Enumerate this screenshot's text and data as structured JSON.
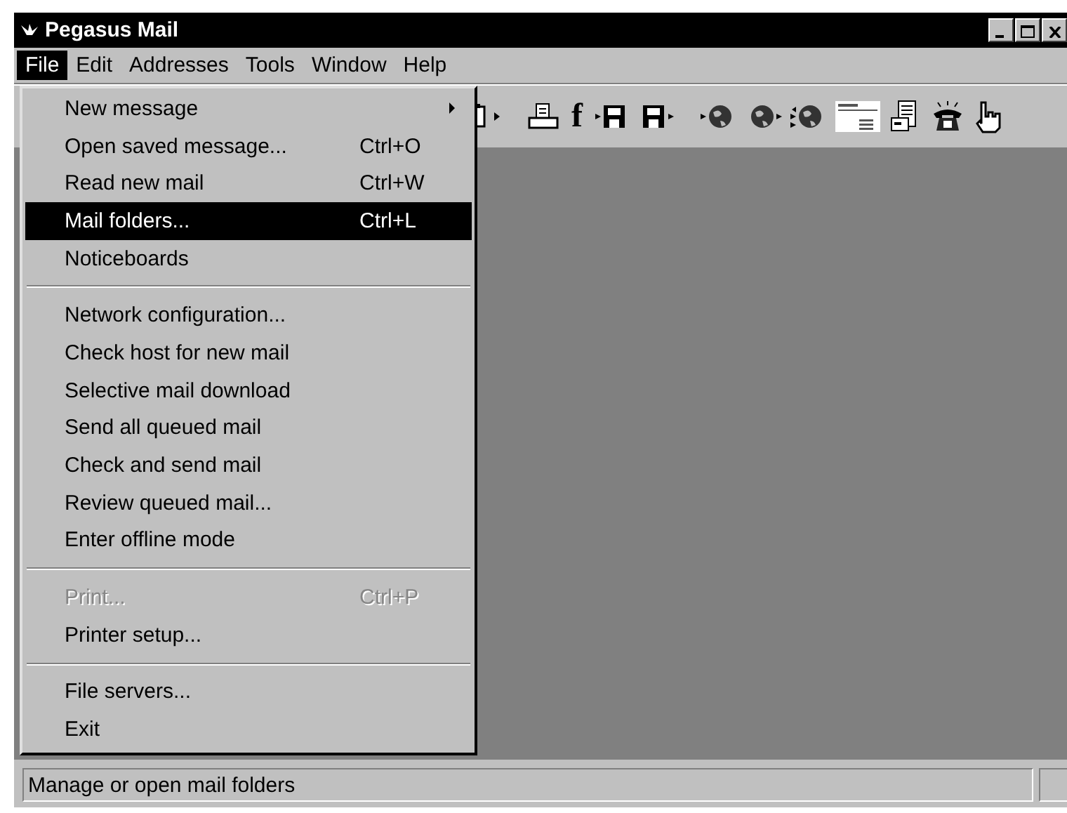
{
  "window": {
    "title": "Pegasus Mail"
  },
  "menu_bar": [
    {
      "label": "File",
      "selected": true
    },
    {
      "label": "Edit",
      "selected": false
    },
    {
      "label": "Addresses",
      "selected": false
    },
    {
      "label": "Tools",
      "selected": false
    },
    {
      "label": "Window",
      "selected": false
    },
    {
      "label": "Help",
      "selected": false
    }
  ],
  "toolbar": [
    {
      "kind": "clipboard-out"
    },
    {
      "kind": "gap"
    },
    {
      "kind": "printer"
    },
    {
      "kind": "letter",
      "label": "f"
    },
    {
      "kind": "disk-in"
    },
    {
      "kind": "disk-out"
    },
    {
      "kind": "gap"
    },
    {
      "kind": "globe-in"
    },
    {
      "kind": "globe-out"
    },
    {
      "kind": "globe-both"
    },
    {
      "kind": "form"
    },
    {
      "kind": "document"
    },
    {
      "kind": "phone"
    },
    {
      "kind": "hand"
    }
  ],
  "file_menu": {
    "groups": [
      [
        {
          "label": "New message",
          "submenu": true,
          "selected": false,
          "disabled": false
        },
        {
          "label": "Open saved message...",
          "shortcut": "Ctrl+O",
          "submenu": false,
          "selected": false,
          "disabled": false
        },
        {
          "label": "Read new mail",
          "shortcut": "Ctrl+W",
          "submenu": false,
          "selected": false,
          "disabled": false
        },
        {
          "label": "Mail folders...",
          "shortcut": "Ctrl+L",
          "submenu": false,
          "selected": true,
          "disabled": false
        },
        {
          "label": "Noticeboards",
          "submenu": false,
          "selected": false,
          "disabled": false
        }
      ],
      [
        {
          "label": "Network configuration...",
          "submenu": false,
          "selected": false,
          "disabled": false
        },
        {
          "label": "Check host for new mail",
          "submenu": false,
          "selected": false,
          "disabled": false
        },
        {
          "label": "Selective mail download",
          "submenu": false,
          "selected": false,
          "disabled": false
        },
        {
          "label": "Send all queued mail",
          "submenu": false,
          "selected": false,
          "disabled": false
        },
        {
          "label": "Check and send mail",
          "submenu": false,
          "selected": false,
          "disabled": false
        },
        {
          "label": "Review queued mail...",
          "submenu": false,
          "selected": false,
          "disabled": false
        },
        {
          "label": "Enter offline mode",
          "submenu": false,
          "selected": false,
          "disabled": false
        }
      ],
      [
        {
          "label": "Print...",
          "shortcut": "Ctrl+P",
          "submenu": false,
          "selected": false,
          "disabled": true
        },
        {
          "label": "Printer setup...",
          "submenu": false,
          "selected": false,
          "disabled": false
        }
      ],
      [
        {
          "label": "File servers...",
          "submenu": false,
          "selected": false,
          "disabled": false
        },
        {
          "label": "Exit",
          "submenu": false,
          "selected": false,
          "disabled": false
        }
      ]
    ]
  },
  "status_bar": {
    "message": "Manage or open mail folders"
  }
}
